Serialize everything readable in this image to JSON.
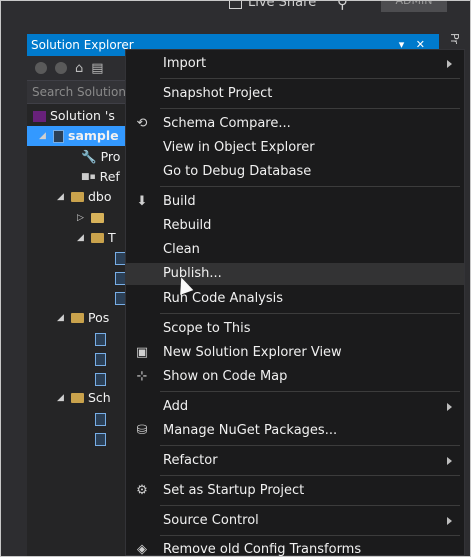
{
  "top": {
    "live_share": "Live Share",
    "admin": "ADMIN",
    "side_tab": "Pr"
  },
  "solution_explorer": {
    "title": "Solution Explorer",
    "search_placeholder": "Search Solution",
    "tree": [
      {
        "label": "Solution 's"
      },
      {
        "label": "sample"
      },
      {
        "label": "Pro"
      },
      {
        "label": "Ref"
      },
      {
        "label": "dbo"
      },
      {
        "label": ""
      },
      {
        "label": "T"
      },
      {
        "label": ""
      },
      {
        "label": ""
      },
      {
        "label": ""
      },
      {
        "label": "Pos"
      },
      {
        "label": ""
      },
      {
        "label": ""
      },
      {
        "label": ""
      },
      {
        "label": "Sch"
      },
      {
        "label": ""
      },
      {
        "label": ""
      }
    ]
  },
  "context_menu": {
    "items": [
      {
        "label": "Import",
        "icon": "",
        "submenu": true
      },
      {
        "label": "Snapshot Project",
        "icon": "",
        "submenu": false
      },
      {
        "label": "Schema Compare...",
        "icon": "schema-compare-icon",
        "submenu": false
      },
      {
        "label": "View in Object Explorer",
        "icon": "",
        "submenu": false
      },
      {
        "label": "Go to Debug Database",
        "icon": "",
        "submenu": false
      },
      {
        "label": "Build",
        "icon": "build-icon",
        "submenu": false
      },
      {
        "label": "Rebuild",
        "icon": "",
        "submenu": false
      },
      {
        "label": "Clean",
        "icon": "",
        "submenu": false
      },
      {
        "label": "Publish...",
        "icon": "",
        "submenu": false
      },
      {
        "label": "Run Code Analysis",
        "icon": "",
        "submenu": false
      },
      {
        "label": "Scope to This",
        "icon": "",
        "submenu": false
      },
      {
        "label": "New Solution Explorer View",
        "icon": "new-view-icon",
        "submenu": false
      },
      {
        "label": "Show on Code Map",
        "icon": "code-map-icon",
        "submenu": false
      },
      {
        "label": "Add",
        "icon": "",
        "submenu": true
      },
      {
        "label": "Manage NuGet Packages...",
        "icon": "nuget-icon",
        "submenu": false
      },
      {
        "label": "Refactor",
        "icon": "",
        "submenu": true
      },
      {
        "label": "Set as Startup Project",
        "icon": "gear-icon",
        "submenu": false
      },
      {
        "label": "Source Control",
        "icon": "",
        "submenu": true
      },
      {
        "label": "Remove old Config Transforms",
        "icon": "config-transform-icon",
        "submenu": false
      }
    ],
    "hovered": "Publish..."
  },
  "colors": {
    "accent": "#007acc",
    "selection": "#3399ff",
    "menu_bg": "#1b1b1c"
  }
}
